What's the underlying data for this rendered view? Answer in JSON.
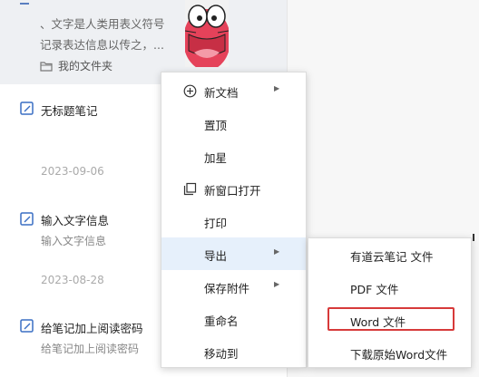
{
  "top_note": {
    "snippet_line1": "、文字是人类用表义符号",
    "snippet_line2": "记录表达信息以传之，...",
    "folder_icon": "folder-icon",
    "folder": "我的文件夹"
  },
  "notes": [
    {
      "icon": "note-edit-icon",
      "title": "无标题笔记",
      "subtitle": "",
      "date": "2023-09-06"
    },
    {
      "icon": "note-edit-icon",
      "title": "输入文字信息",
      "subtitle": "输入文字信息",
      "date": "2023-08-28"
    },
    {
      "icon": "note-edit-icon",
      "title": "给笔记加上阅读密码",
      "subtitle": "给笔记加上阅读密码",
      "date": ""
    }
  ],
  "context_menu": {
    "items": [
      {
        "label": "新文档",
        "icon": "plus-circle-icon",
        "has_submenu": true
      },
      {
        "label": "置顶",
        "icon": "",
        "has_submenu": false
      },
      {
        "label": "加星",
        "icon": "",
        "has_submenu": false
      },
      {
        "label": "新窗口打开",
        "icon": "new-window-icon",
        "has_submenu": false
      },
      {
        "label": "打印",
        "icon": "",
        "has_submenu": false
      },
      {
        "label": "导出",
        "icon": "",
        "has_submenu": true,
        "active": true
      },
      {
        "label": "保存附件",
        "icon": "",
        "has_submenu": true
      },
      {
        "label": "重命名",
        "icon": "",
        "has_submenu": false
      },
      {
        "label": "移动到",
        "icon": "",
        "has_submenu": false
      }
    ]
  },
  "export_submenu": {
    "items": [
      {
        "label": "有道云笔记 文件"
      },
      {
        "label": "PDF 文件"
      },
      {
        "label": "Word 文件",
        "highlighted": true
      },
      {
        "label": "下载原始Word文件"
      }
    ]
  },
  "colors": {
    "accent_blue": "#3a6fc4",
    "menu_hover": "#e6f0fb",
    "highlight_red": "#d73a3a",
    "list_selected_bg": "#eef0f3"
  }
}
